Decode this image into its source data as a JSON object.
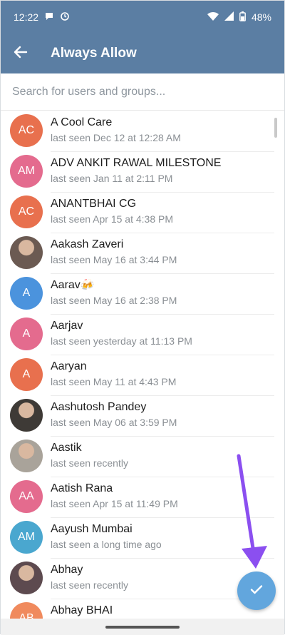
{
  "status_bar": {
    "time": "12:22",
    "battery": "48%",
    "icons": [
      "message-icon",
      "clock-icon",
      "wifi-icon",
      "signal-icon",
      "battery-icon"
    ]
  },
  "header": {
    "title": "Always Allow",
    "back_icon": "arrow-left-icon"
  },
  "search": {
    "placeholder": "Search for users and groups..."
  },
  "contacts": [
    {
      "name": "A Cool Care",
      "status": "last seen Dec 12 at 12:28 AM",
      "initials": "AC",
      "color": "#e8704e"
    },
    {
      "name": "ADV ANKIT RAWAL MILESTONE",
      "status": "last seen Jan 11 at 2:11 PM",
      "initials": "AM",
      "color": "#e46b8e"
    },
    {
      "name": "ANANTBHAI CG",
      "status": "last seen Apr 15 at 4:38 PM",
      "initials": "AC",
      "color": "#e8704e"
    },
    {
      "name": "Aakash Zaveri",
      "status": "last seen May 16 at 3:44 PM",
      "initials": "",
      "color": "#6b5a52"
    },
    {
      "name": "Aarav🍻",
      "status": "last seen May 16 at 2:38 PM",
      "initials": "A",
      "color": "#4b93dd"
    },
    {
      "name": "Aarjav",
      "status": "last seen yesterday at 11:13 PM",
      "initials": "A",
      "color": "#e46b8e"
    },
    {
      "name": "Aaryan",
      "status": "last seen May 11 at 4:43 PM",
      "initials": "A",
      "color": "#e8704e"
    },
    {
      "name": "Aashutosh Pandey",
      "status": "last seen May 06 at 3:59 PM",
      "initials": "",
      "color": "#3e3a36"
    },
    {
      "name": "Aastik",
      "status": "last seen recently",
      "initials": "",
      "color": "#a9a39a"
    },
    {
      "name": "Aatish Rana",
      "status": "last seen Apr 15 at 11:49 PM",
      "initials": "AA",
      "color": "#e46b8e"
    },
    {
      "name": "Aayush Mumbai",
      "status": "last seen a long time ago",
      "initials": "AM",
      "color": "#4aa7cf"
    },
    {
      "name": "Abhay",
      "status": "last seen recently",
      "initials": "",
      "color": "#5d4a4f"
    },
    {
      "name": "Abhay BHAI",
      "status": "",
      "initials": "AB",
      "color": "#f08a5d"
    }
  ],
  "fab": {
    "icon": "check-icon",
    "color": "#62a6dd"
  },
  "annotation": {
    "color": "#8b4ff0"
  }
}
